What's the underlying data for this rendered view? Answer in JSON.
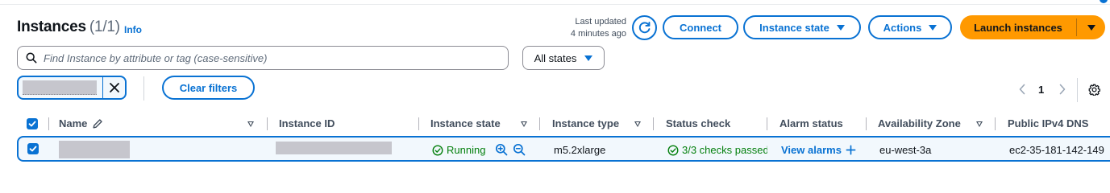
{
  "header": {
    "title": "Instances",
    "count": "(1/1)",
    "info_link": "Info",
    "last_updated_line1": "Last updated",
    "last_updated_line2": "4 minutes ago"
  },
  "toolbar": {
    "connect_label": "Connect",
    "instance_state_label": "Instance state",
    "actions_label": "Actions",
    "launch_label": "Launch instances"
  },
  "search": {
    "placeholder": "Find Instance by attribute or tag (case-sensitive)"
  },
  "state_filter": {
    "selected": "All states"
  },
  "filters": {
    "clear_label": "Clear filters"
  },
  "pagination": {
    "current_page": "1"
  },
  "table": {
    "columns": [
      {
        "label": "Name",
        "editable": true,
        "sortable": true
      },
      {
        "label": "Instance ID",
        "sortable": false
      },
      {
        "label": "Instance state",
        "sortable": true
      },
      {
        "label": "Instance type",
        "sortable": true
      },
      {
        "label": "Status check",
        "sortable": false
      },
      {
        "label": "Alarm status",
        "sortable": false
      },
      {
        "label": "Availability Zone",
        "sortable": true
      },
      {
        "label": "Public IPv4 DNS",
        "sortable": false
      }
    ],
    "rows": [
      {
        "selected": true,
        "instance_state": "Running",
        "instance_type": "m5.2xlarge",
        "status_check": "3/3 checks passed",
        "alarm_status": "View alarms",
        "availability_zone": "eu-west-3a",
        "public_dns": "ec2-35-181-142-149"
      }
    ]
  },
  "colors": {
    "accent": "#0972d3",
    "launch": "#ff9900",
    "success": "#037f0c"
  },
  "icons": [
    "refresh-icon",
    "search-icon",
    "close-icon",
    "pencil-icon",
    "check-circle-icon",
    "zoom-in-icon",
    "zoom-out-icon",
    "plus-icon",
    "chevron-left-icon",
    "chevron-right-icon",
    "gear-icon"
  ]
}
